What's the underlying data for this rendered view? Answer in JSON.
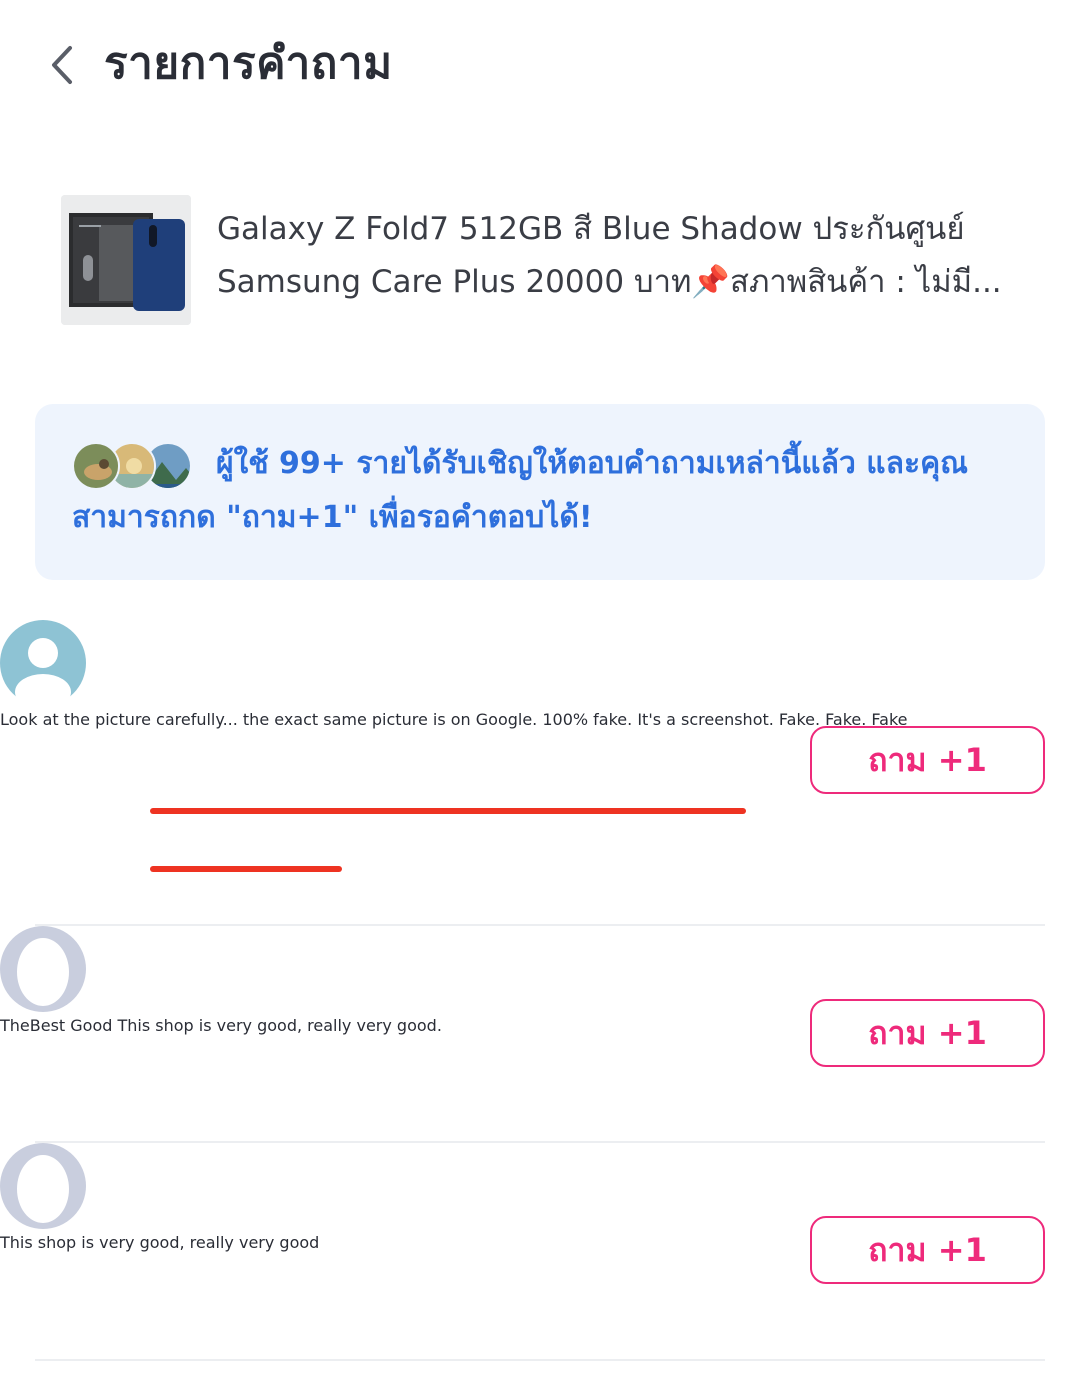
{
  "header": {
    "title": "รายการคำถาม"
  },
  "product": {
    "title": "Galaxy Z Fold7 512GB สี Blue Shadow ประกันศูนย์ Samsung Care Plus 20000 บาท📌สภาพสินค้า : ไม่มี..."
  },
  "banner": {
    "text": "ผู้ใช้ 99+ รายได้รับเชิญให้ตอบคำถามเหล่านี้แล้ว และคุณสามารถกด \"ถาม+1\" เพื่อรอคำตอบได้!",
    "color": "#2e6fdc"
  },
  "questions": [
    {
      "text": "Look at the picture carefully... the exact same picture is on Google. 100% fake. It's a screenshot. Fake. Fake. Fake",
      "ask_label": "ถาม +1"
    },
    {
      "text": "TheBest Good This shop is very good, really very good.",
      "ask_label": "ถาม +1"
    },
    {
      "text": "This shop is very good, really very good",
      "ask_label": "ถาม +1"
    }
  ],
  "colors": {
    "accent": "#ee2a7b",
    "annotation_underline": "#ee3322",
    "banner_bg": "#eef4fd"
  }
}
